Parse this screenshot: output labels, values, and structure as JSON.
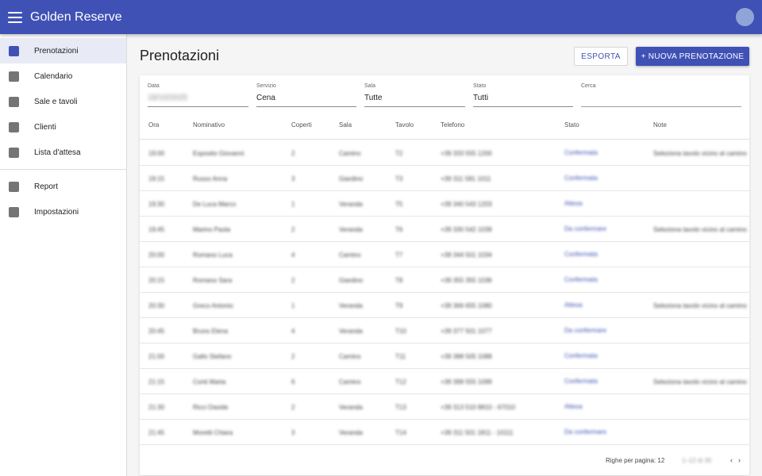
{
  "app": {
    "title": "Golden Reserve"
  },
  "sidebar": {
    "items": [
      {
        "label": "Prenotazioni",
        "active": true
      },
      {
        "label": "Calendario"
      },
      {
        "label": "Sale e tavoli"
      },
      {
        "label": "Clienti"
      },
      {
        "label": "Lista d'attesa"
      }
    ],
    "items2": [
      {
        "label": "Report"
      },
      {
        "label": "Impostazioni"
      }
    ]
  },
  "main": {
    "title": "Prenotazioni",
    "export_label": "ESPORTA",
    "new_label": "+ NUOVA PRENOTAZIONE"
  },
  "filters": {
    "date": {
      "label": "Data",
      "value": "18/10/2025"
    },
    "service": {
      "label": "Servizio",
      "value": "Cena"
    },
    "room": {
      "label": "Sala",
      "value": "Tutte"
    },
    "status": {
      "label": "Stato",
      "value": "Tutti"
    },
    "search": {
      "label": "Cerca",
      "value": ""
    }
  },
  "table": {
    "headers": [
      "Ora",
      "Nominativo",
      "Coperti",
      "Sala",
      "Tavolo",
      "Telefono",
      "Stato",
      "Note"
    ],
    "rows": [
      {
        "time": "19:00",
        "name": "Esposito Giovanni",
        "covers": "2",
        "room": "Camino",
        "table": "T2",
        "phone": "+39 333 555 1200",
        "status": "Confermata",
        "note": "Seleziona tavolo vicino al camino"
      },
      {
        "time": "19:15",
        "name": "Russo Anna",
        "covers": "3",
        "room": "Giardino",
        "table": "T3",
        "phone": "+39 311 581 1011",
        "status": "Confermata",
        "note": ""
      },
      {
        "time": "19:30",
        "name": "De Luca Marco",
        "covers": "1",
        "room": "Veranda",
        "table": "T5",
        "phone": "+39 340 543 1203",
        "status": "Attesa",
        "note": ""
      },
      {
        "time": "19:45",
        "name": "Marino Paola",
        "covers": "2",
        "room": "Veranda",
        "table": "T6",
        "phone": "+39 330 542 1039",
        "status": "Da confermare",
        "note": "Seleziona tavolo vicino al camino"
      },
      {
        "time": "20:00",
        "name": "Romano Luca",
        "covers": "4",
        "room": "Camino",
        "table": "T7",
        "phone": "+39 344 501 1034",
        "status": "Confermata",
        "note": ""
      },
      {
        "time": "20:15",
        "name": "Romano Sara",
        "covers": "2",
        "room": "Giardino",
        "table": "T8",
        "phone": "+39 355 355 1036",
        "status": "Confermata",
        "note": ""
      },
      {
        "time": "20:30",
        "name": "Greco Antonio",
        "covers": "1",
        "room": "Veranda",
        "table": "T9",
        "phone": "+39 366 655 1080",
        "status": "Attesa",
        "note": "Seleziona tavolo vicino al camino"
      },
      {
        "time": "20:45",
        "name": "Bruno Elena",
        "covers": "4",
        "room": "Veranda",
        "table": "T10",
        "phone": "+39 377 501 1077",
        "status": "Da confermare",
        "note": ""
      },
      {
        "time": "21:00",
        "name": "Gallo Stefano",
        "covers": "2",
        "room": "Camino",
        "table": "T11",
        "phone": "+39 388 505 1088",
        "status": "Confermata",
        "note": ""
      },
      {
        "time": "21:15",
        "name": "Conti Marta",
        "covers": "6",
        "room": "Camino",
        "table": "T12",
        "phone": "+39 399 555 1099",
        "status": "Confermata",
        "note": "Seleziona tavolo vicino al camino"
      },
      {
        "time": "21:30",
        "name": "Ricci Davide",
        "covers": "2",
        "room": "Veranda",
        "table": "T13",
        "phone": "+39 313 510 8810 - 67010",
        "status": "Attesa",
        "note": ""
      },
      {
        "time": "21:45",
        "name": "Moretti Chiara",
        "covers": "3",
        "room": "Veranda",
        "table": "T14",
        "phone": "+39 311 501 1811 - 10111",
        "status": "Da confermare",
        "note": ""
      }
    ]
  },
  "footer": {
    "rows_per_page": "Righe per pagina: 12",
    "range": "1–12 di 30",
    "prev": "‹",
    "next": "›"
  },
  "colors": {
    "primary": "#3f51b5",
    "status_text": "#3f51b5"
  },
  "icons": {
    "menu": "hamburger-menu-icon",
    "nav": "square-nav-icon",
    "avatar": "user-avatar"
  }
}
